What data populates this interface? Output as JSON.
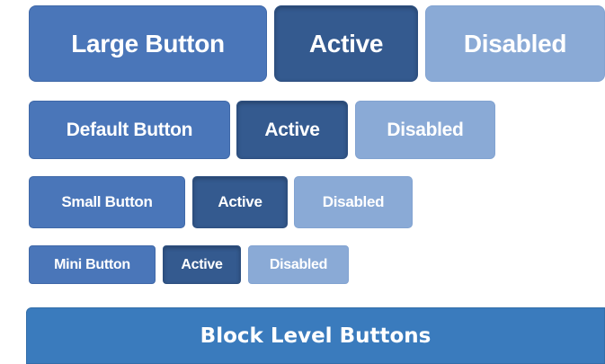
{
  "colors": {
    "primary": "#4a76b9",
    "active": "#345a8f",
    "disabled": "#8aaad6",
    "block": "#3a7bbd",
    "text": "#ffffff"
  },
  "rows": {
    "large": {
      "default_label": "Large Button",
      "active_label": "Active",
      "disabled_label": "Disabled"
    },
    "default": {
      "default_label": "Default Button",
      "active_label": "Active",
      "disabled_label": "Disabled"
    },
    "small": {
      "default_label": "Small Button",
      "active_label": "Active",
      "disabled_label": "Disabled"
    },
    "mini": {
      "default_label": "Mini Button",
      "active_label": "Active",
      "disabled_label": "Disabled"
    }
  },
  "block": {
    "label": "Block Level Buttons"
  }
}
